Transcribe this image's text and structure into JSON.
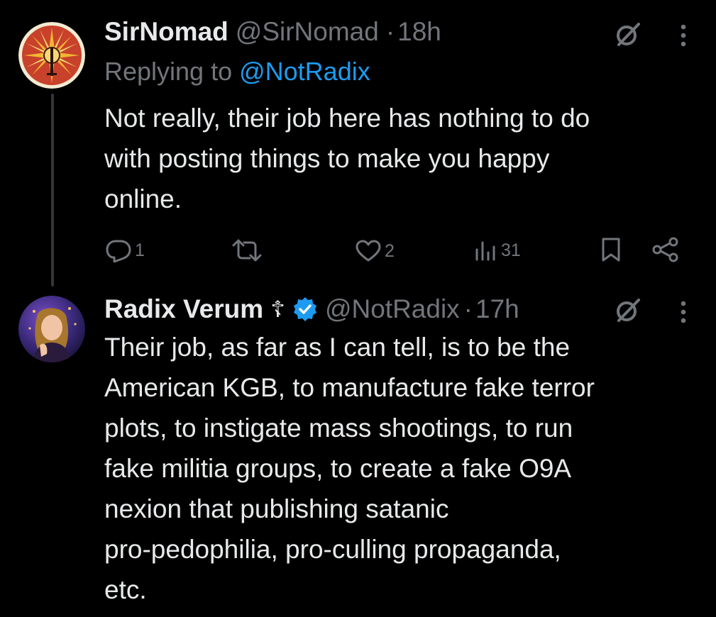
{
  "tweets": [
    {
      "display_name": "SirNomad",
      "handle": "@SirNomad",
      "separator": "·",
      "time": "18h",
      "reply_prefix": "Replying to ",
      "reply_to": "@NotRadix",
      "text": "Not really, their job here has nothing to do\nwith posting things to make you happy\nonline.",
      "actions": {
        "replies": "1",
        "retweets": "",
        "likes": "2",
        "views": "31"
      },
      "icons": [
        "grok-icon",
        "more-icon",
        "reply-icon",
        "retweet-icon",
        "like-icon",
        "views-icon",
        "bookmark-icon",
        "share-icon"
      ]
    },
    {
      "display_name": "Radix Verum",
      "name_symbol": "☦",
      "handle": "@NotRadix",
      "separator": "·",
      "time": "17h",
      "verified": true,
      "text": "Their job, as far as I can tell, is to be the\nAmerican KGB, to manufacture fake terror\nplots, to instigate mass shootings, to run\nfake militia groups, to create a fake O9A\nnexion that publishing satanic\npro-pedophilia, pro-culling propaganda,\netc.",
      "icons": [
        "grok-icon",
        "more-icon",
        "verified-badge-icon"
      ]
    }
  ],
  "colors": {
    "background": "#000000",
    "text": "#e7e9ea",
    "secondary": "#71767b",
    "link": "#1d9bf0",
    "verified": "#1d9bf0"
  }
}
